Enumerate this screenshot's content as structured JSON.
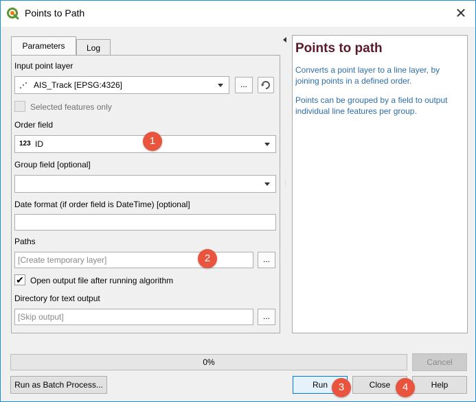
{
  "window": {
    "title": "Points to Path",
    "close_glyph": "✕"
  },
  "tabs": [
    {
      "label": "Parameters"
    },
    {
      "label": "Log"
    }
  ],
  "params": {
    "input_layer_label": "Input point layer",
    "input_layer_value": "AIS_Track [EPSG:4326]",
    "selected_only_label": "Selected features only",
    "order_field_label": "Order field",
    "order_field_type": "123",
    "order_field_value": "ID",
    "group_field_label": "Group field [optional]",
    "group_field_value": "",
    "date_format_label": "Date format (if order field is DateTime) [optional]",
    "date_format_value": "",
    "paths_label": "Paths",
    "paths_placeholder": "[Create temporary layer]",
    "open_output_label": "Open output file after running algorithm",
    "open_output_checked": true,
    "directory_label": "Directory for text output",
    "directory_placeholder": "[Skip output]",
    "dots": "..."
  },
  "help": {
    "title": "Points to path",
    "paragraph1": "Converts a point layer to a line layer, by joining points in a defined order.",
    "paragraph2": "Points can be grouped by a field to output individual line features per group."
  },
  "progress": {
    "value": 0,
    "text": "0%"
  },
  "buttons": {
    "cancel": "Cancel",
    "batch": "Run as Batch Process...",
    "run": "Run",
    "close": "Close",
    "help": "Help"
  },
  "badges": [
    "1",
    "2",
    "3",
    "4"
  ],
  "colors": {
    "accent": "#1e8fd6",
    "badge": "#e8543d",
    "help_title": "#5a1a2a",
    "help_text": "#2e6da4"
  }
}
